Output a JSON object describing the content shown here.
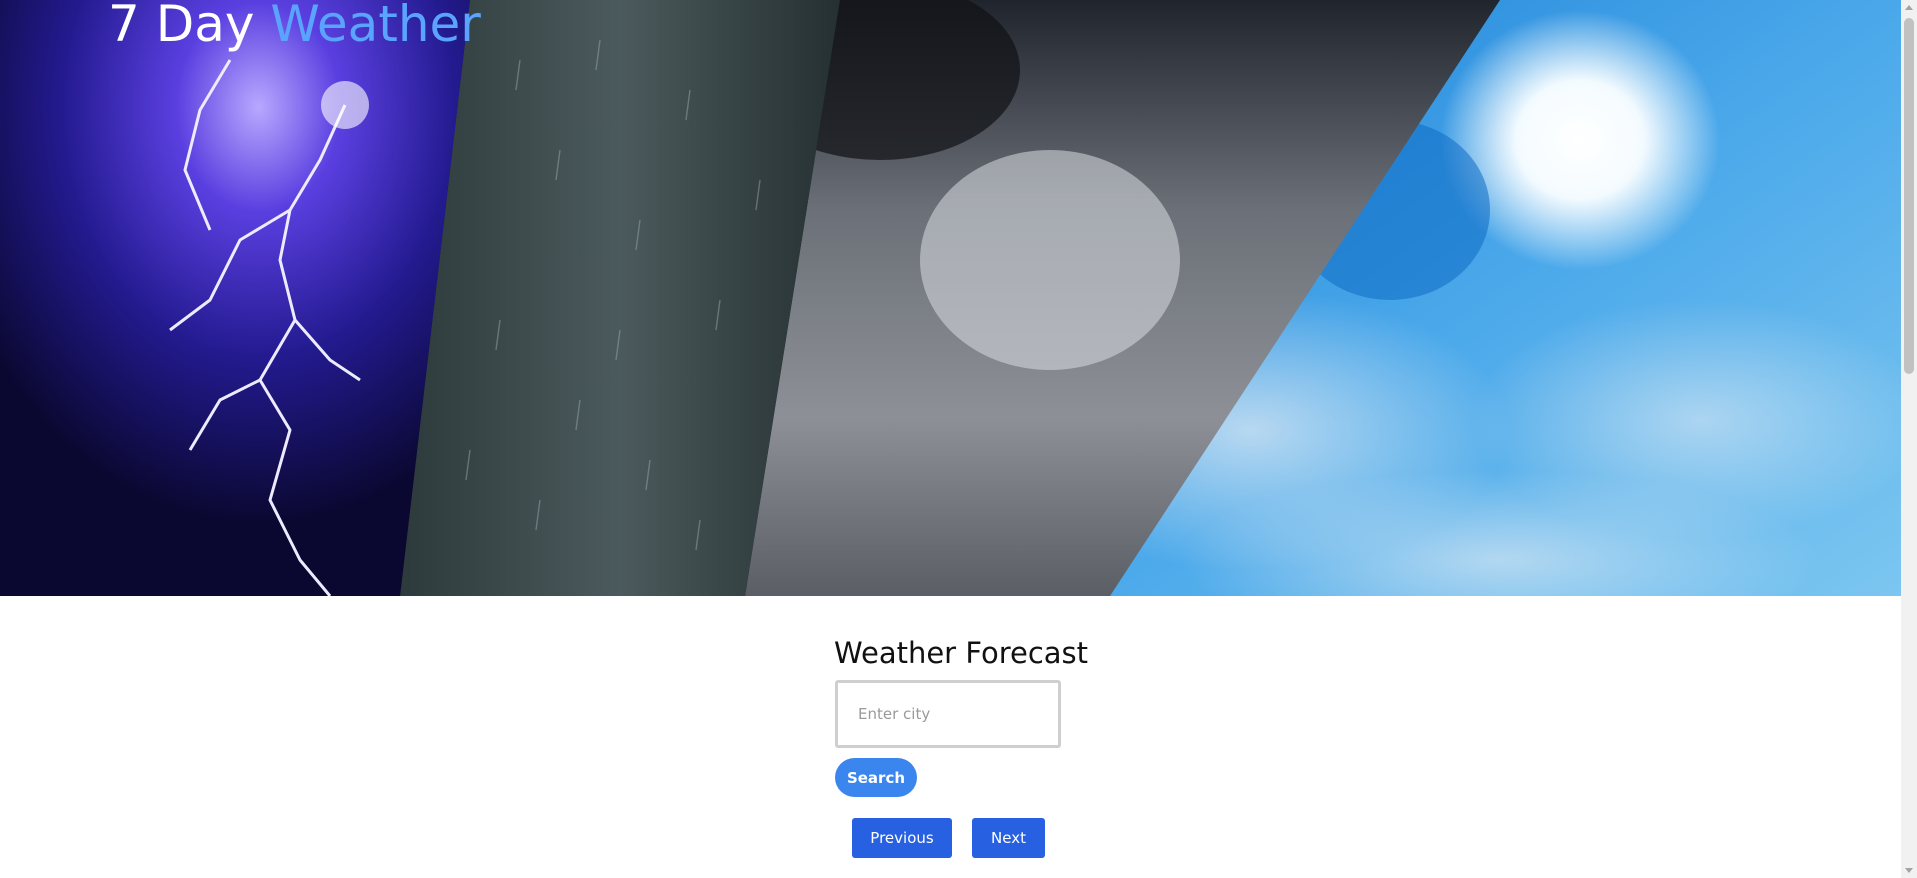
{
  "header": {
    "title_part1": "7 Day ",
    "title_part2": "Weather",
    "accent_color": "#5aa3ff",
    "hero_image": "weather-collage: lightning storm, heavy rain, dark clouds, sunny blue sky"
  },
  "main": {
    "heading": "Weather Forecast",
    "search": {
      "placeholder": "Enter city",
      "value": "",
      "button_label": "Search"
    },
    "pagination": {
      "previous_label": "Previous",
      "next_label": "Next"
    }
  },
  "colors": {
    "search_button": "#3b86ee",
    "nav_button": "#2760e0",
    "input_border": "#cfcfcf"
  }
}
